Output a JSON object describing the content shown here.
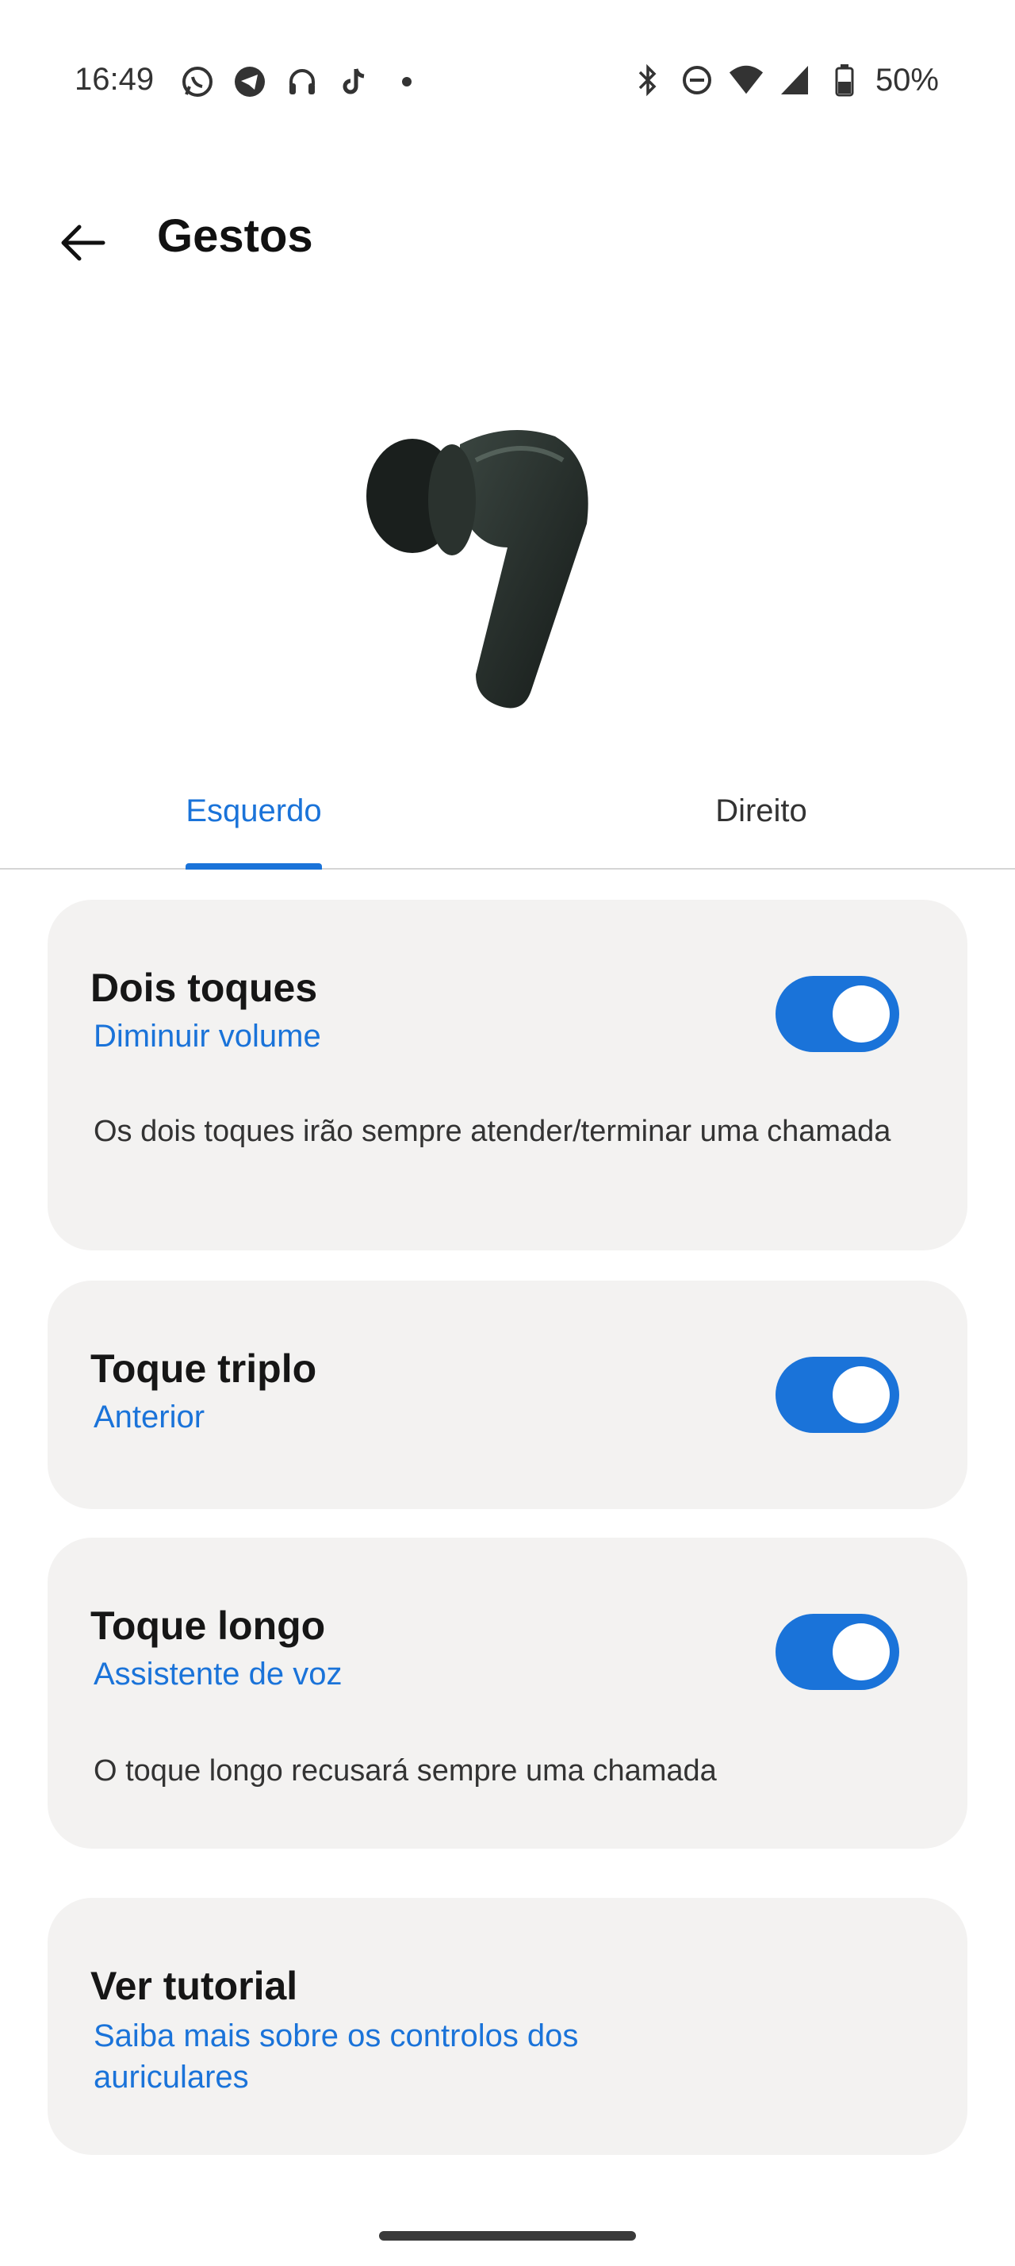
{
  "status": {
    "time": "16:49",
    "battery": "50%",
    "left_icons": [
      "whatsapp-icon",
      "telegram-icon",
      "headphones-icon",
      "tiktok-icon",
      "dot-icon"
    ],
    "right_icons": [
      "bluetooth-icon",
      "dnd-icon",
      "wifi-icon",
      "signal-icon",
      "battery-icon"
    ]
  },
  "header": {
    "title": "Gestos"
  },
  "tabs": [
    {
      "label": "Esquerdo",
      "selected": true
    },
    {
      "label": "Direito",
      "selected": false
    }
  ],
  "cards": [
    {
      "title": "Dois toques",
      "subtitle": "Diminuir volume",
      "description": "Os dois toques irão sempre atender/terminar uma chamada",
      "toggle": true
    },
    {
      "title": "Toque triplo",
      "subtitle": "Anterior",
      "toggle": true
    },
    {
      "title": "Toque longo",
      "subtitle": "Assistente de voz",
      "description": "O toque longo recusará sempre uma chamada",
      "toggle": true
    },
    {
      "title": "Ver tutorial",
      "subtitle": "Saiba mais sobre os controlos dos auriculares"
    }
  ],
  "colors": {
    "accent": "#1a73d9",
    "card_bg": "#f3f2f1"
  }
}
